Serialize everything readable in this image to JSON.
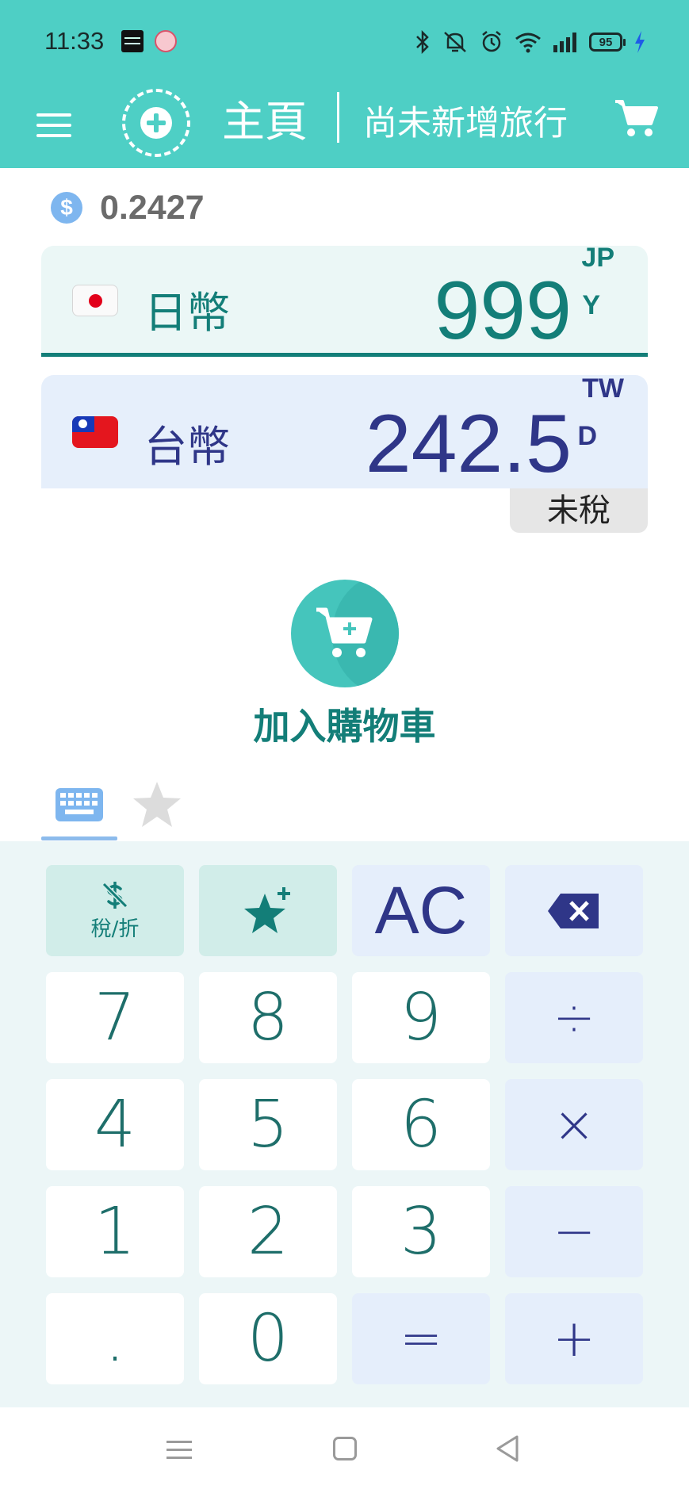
{
  "status_bar": {
    "time": "11:33",
    "battery": "95"
  },
  "toolbar": {
    "title": "主頁",
    "trip": "尚未新增旅行"
  },
  "rate": {
    "icon": "$",
    "value": "0.2427"
  },
  "currencies": {
    "from": {
      "name": "日幣",
      "amount": "999",
      "code_top": "JP",
      "code_bottom": "Y"
    },
    "to": {
      "name": "台幣",
      "amount": "242.5",
      "code_top": "TW",
      "code_bottom": "D"
    }
  },
  "tax_status": "未稅",
  "add_to_cart": "加入購物車",
  "keypad": {
    "tax_label": "稅/折",
    "clear": "AC",
    "digits": [
      "7",
      "8",
      "9",
      "4",
      "5",
      "6",
      "1",
      "2",
      "3",
      ".",
      "0"
    ],
    "ops": {
      "divide": "÷",
      "multiply": "×",
      "minus": "−",
      "plus": "+",
      "equals": "="
    }
  },
  "colors": {
    "primary": "#4ecfc5",
    "teal_text": "#137e78",
    "navy_text": "#2f3688"
  }
}
